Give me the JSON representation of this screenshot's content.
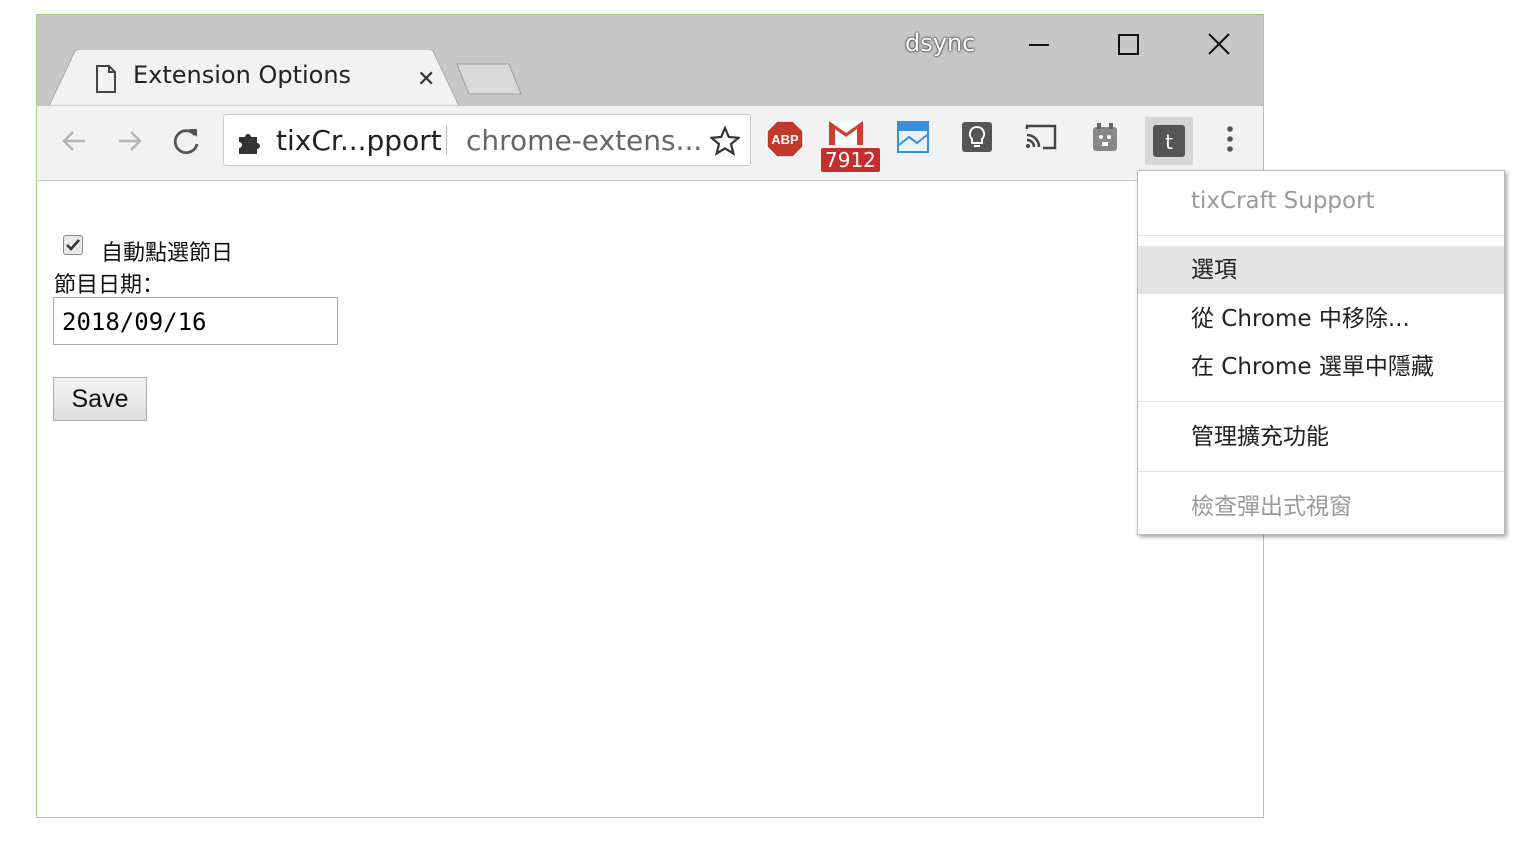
{
  "profile_name": "dsync",
  "tab": {
    "title": "Extension Options",
    "close": "✕"
  },
  "omnibox": {
    "extension_name": "tixCr...pport",
    "url": "chrome-extens..."
  },
  "toolbar": {
    "gmail_badge": "7912",
    "abp_label": "ABP",
    "tixcraft_letter": "t"
  },
  "page": {
    "checkbox_label": "自動點選節日",
    "checkbox_checked": true,
    "date_label": "節目日期：",
    "date_value": "2018/09/16",
    "save_label": "Save"
  },
  "menu": {
    "header": "tixCraft Support",
    "items": [
      {
        "label": "選項",
        "state": "highlighted"
      },
      {
        "label": "從 Chrome 中移除...",
        "state": "enabled"
      },
      {
        "label": "在 Chrome 選單中隱藏",
        "state": "enabled"
      },
      {
        "label": "管理擴充功能",
        "state": "enabled"
      },
      {
        "label": "檢查彈出式視窗",
        "state": "disabled"
      }
    ]
  },
  "colors": {
    "titlebar": "#c7c7c7",
    "toolbar": "#f2f2f2",
    "window_border": "#a9cf82",
    "gmail_badge_bg": "#c62e2e",
    "abp_red": "#c0392b"
  }
}
